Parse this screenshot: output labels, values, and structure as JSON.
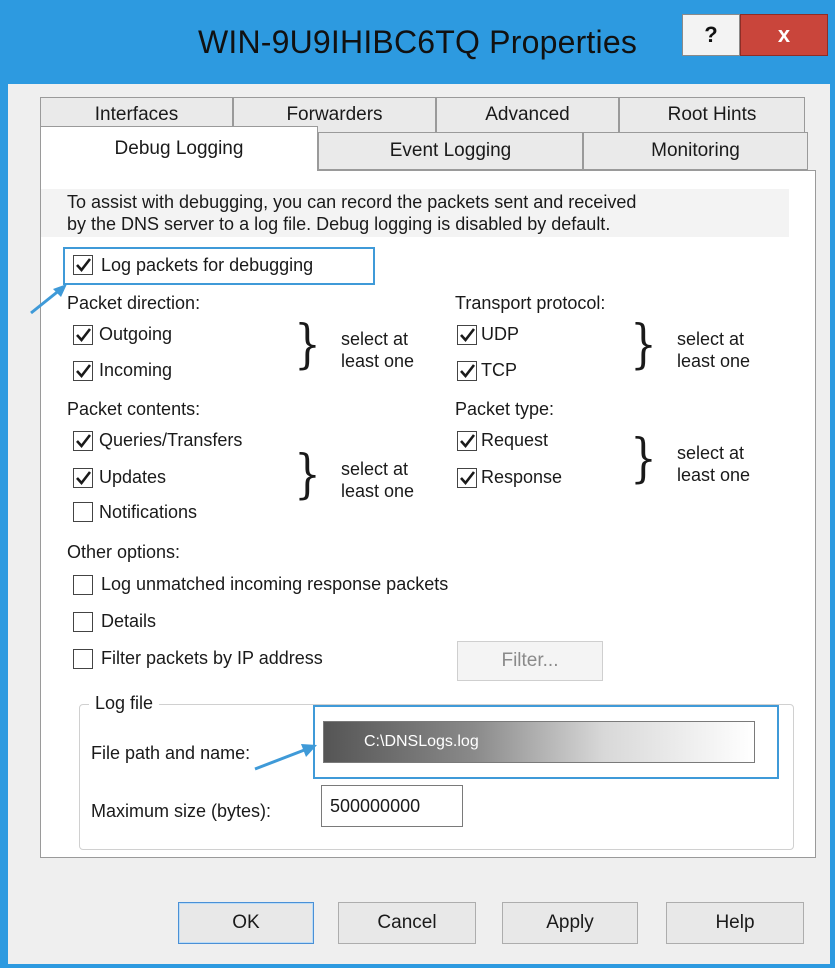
{
  "window": {
    "title": "WIN-9U9IHIBC6TQ Properties",
    "help_label": "?",
    "close_label": "x"
  },
  "tabs_row1": [
    "Interfaces",
    "Forwarders",
    "Advanced",
    "Root Hints"
  ],
  "tabs_row2": [
    "Debug Logging",
    "Event Logging",
    "Monitoring"
  ],
  "active_tab": "Debug Logging",
  "panel": {
    "description_line1": "To assist with debugging, you can record the packets sent and received",
    "description_line2": "by the DNS server to a log file. Debug logging is disabled by default.",
    "log_packets": {
      "label": "Log packets for debugging",
      "checked": true
    },
    "packet_direction": {
      "heading": "Packet direction:",
      "outgoing": {
        "label": "Outgoing",
        "checked": true
      },
      "incoming": {
        "label": "Incoming",
        "checked": true
      },
      "hint_line1": "select at",
      "hint_line2": "least one"
    },
    "transport_protocol": {
      "heading": "Transport protocol:",
      "udp": {
        "label": "UDP",
        "checked": true
      },
      "tcp": {
        "label": "TCP",
        "checked": true
      },
      "hint_line1": "select at",
      "hint_line2": "least one"
    },
    "packet_contents": {
      "heading": "Packet contents:",
      "queries": {
        "label": "Queries/Transfers",
        "checked": true
      },
      "updates": {
        "label": "Updates",
        "checked": true
      },
      "notifications": {
        "label": "Notifications",
        "checked": false
      },
      "hint_line1": "select at",
      "hint_line2": "least one"
    },
    "packet_type": {
      "heading": "Packet type:",
      "request": {
        "label": "Request",
        "checked": true
      },
      "response": {
        "label": "Response",
        "checked": true
      },
      "hint_line1": "select at",
      "hint_line2": "least one"
    },
    "other_options": {
      "heading": "Other options:",
      "log_unmatched": {
        "label": "Log unmatched incoming response packets",
        "checked": false
      },
      "details": {
        "label": "Details",
        "checked": false
      },
      "filter_by_ip": {
        "label": "Filter packets by IP address",
        "checked": false
      },
      "filter_button": "Filter..."
    },
    "log_file": {
      "legend": "Log file",
      "path_label": "File path and name:",
      "path_value": "C:\\DNSLogs.log",
      "max_size_label": "Maximum size (bytes):",
      "max_size_value": "500000000"
    }
  },
  "buttons": {
    "ok": "OK",
    "cancel": "Cancel",
    "apply": "Apply",
    "help": "Help"
  },
  "colors": {
    "frame": "#2d9ae0",
    "close": "#c9453b",
    "highlight": "#3f9ad8"
  }
}
